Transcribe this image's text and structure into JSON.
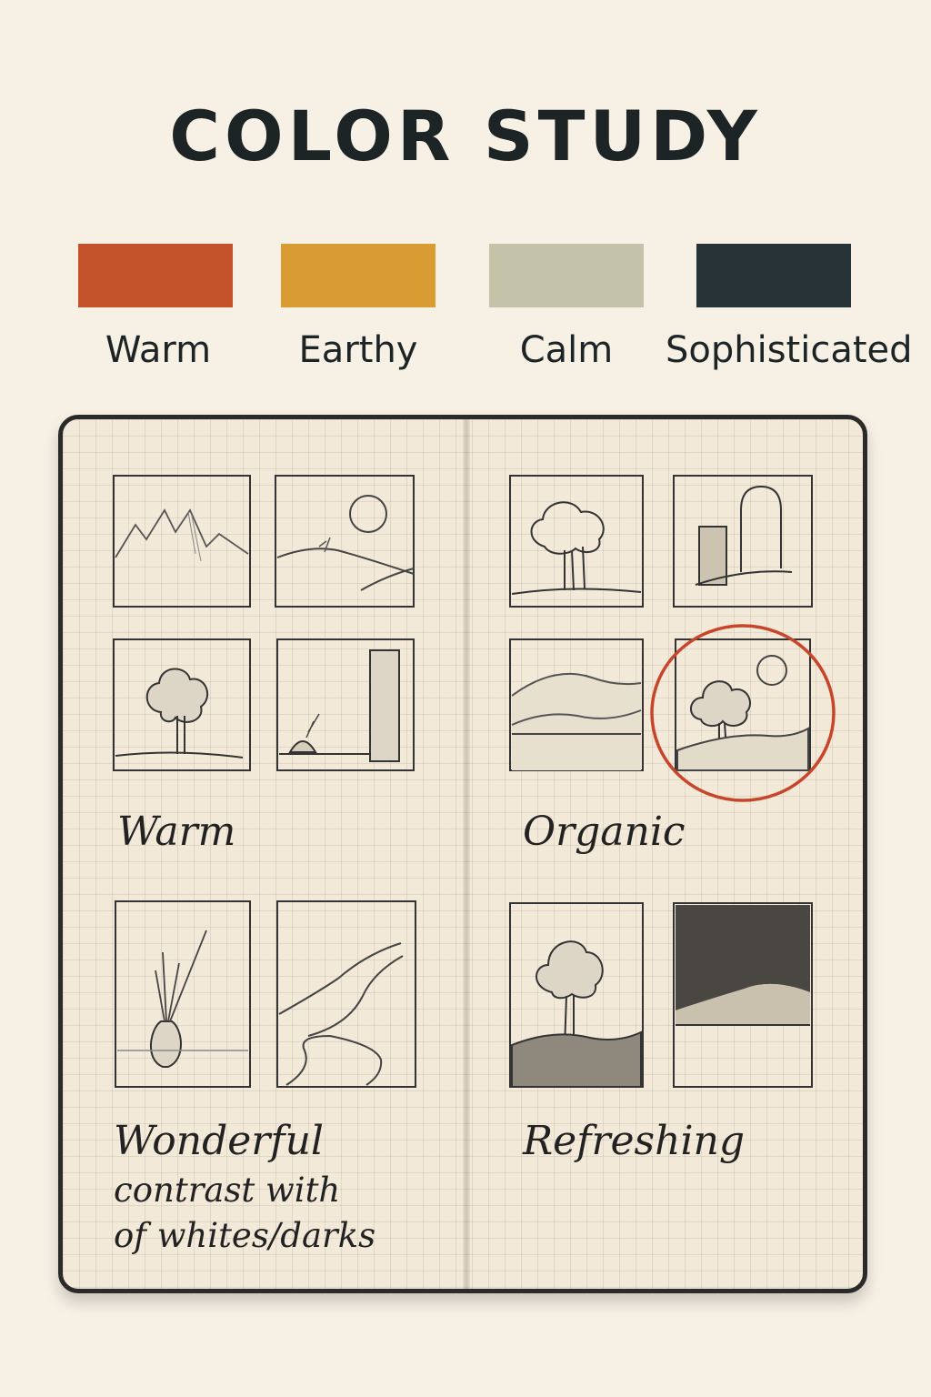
{
  "title": "COLOR STUDY",
  "palette": [
    {
      "label": "Warm",
      "color": "#c4522a"
    },
    {
      "label": "Earthy",
      "color": "#d89c33"
    },
    {
      "label": "Calm",
      "color": "#c5c2aa"
    },
    {
      "label": "Sophisticated",
      "color": "#283337"
    }
  ],
  "notebook": {
    "groups": {
      "warm": "Warm",
      "organic": "Organic",
      "wonderful": [
        "Wonderful",
        "contrast with",
        "of whites/darks"
      ],
      "refreshing": "Refreshing"
    },
    "sketches": [
      "mountains",
      "sun-hills",
      "tree",
      "figure-pillar",
      "tree-bush",
      "block-arch",
      "hills",
      "tree-sun-hills",
      "grass-vase",
      "winding-road",
      "tree-dark-ground",
      "dark-sky-hills"
    ],
    "highlight": {
      "sketch": "tree-sun-hills",
      "color": "#c7452b"
    }
  }
}
